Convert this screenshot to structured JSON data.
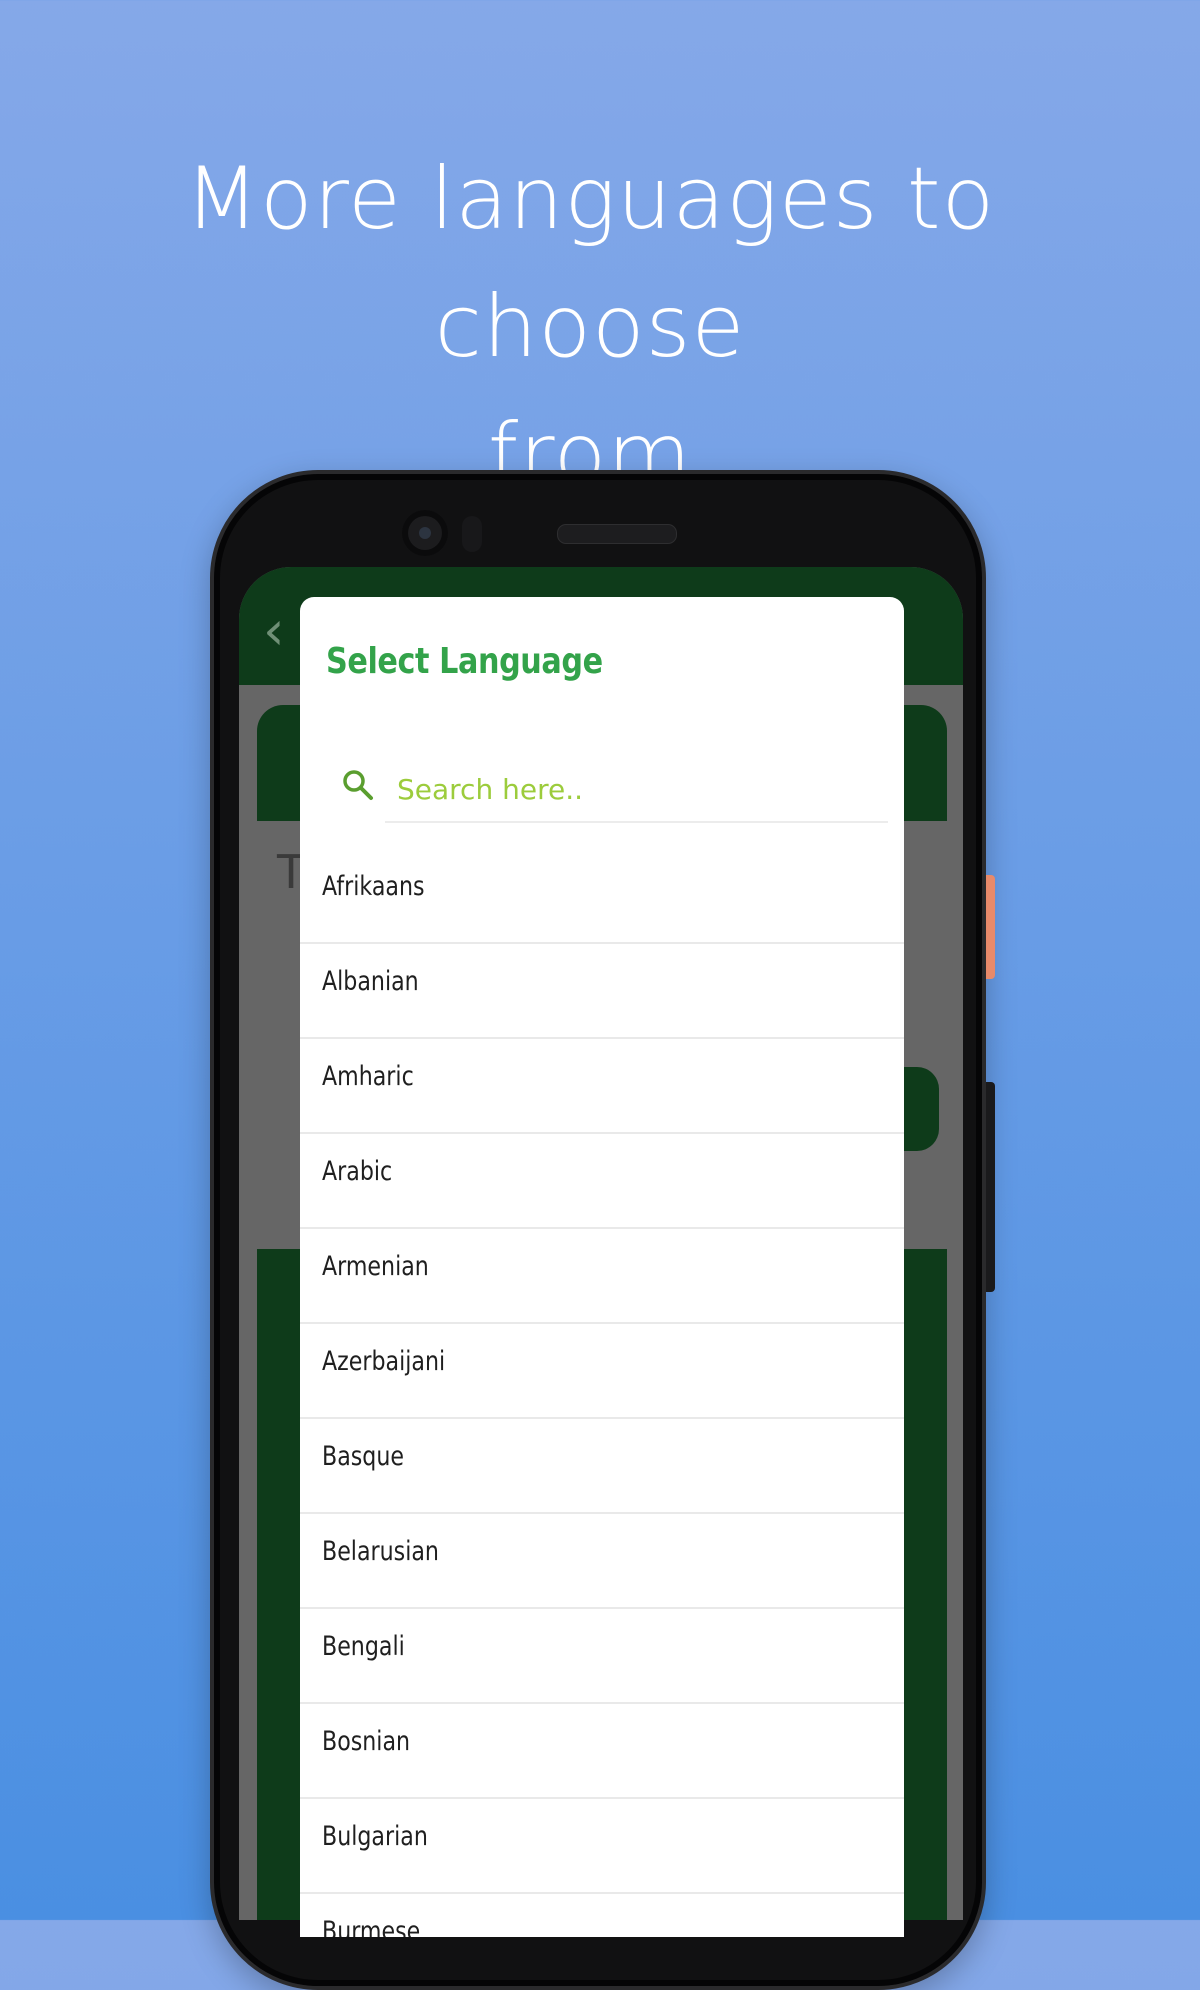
{
  "promo": {
    "headline_line1": "More languages to choose",
    "headline_line2": "from"
  },
  "dialog": {
    "title": "Select Language",
    "search": {
      "placeholder": "Search here..",
      "value": ""
    },
    "languages": [
      "Afrikaans",
      "Albanian",
      "Amharic",
      "Arabic",
      "Armenian",
      "Azerbaijani",
      "Basque",
      "Belarusian",
      "Bengali",
      "Bosnian",
      "Bulgarian",
      "Burmese"
    ]
  },
  "background_app": {
    "back_icon": "chevron-left-icon",
    "partial_letter": "T"
  },
  "colors": {
    "accent_green": "#33a34a",
    "placeholder_green": "#9ccc3c",
    "app_dark_green": "#0e3b1a",
    "scrim_gray": "#666666"
  }
}
